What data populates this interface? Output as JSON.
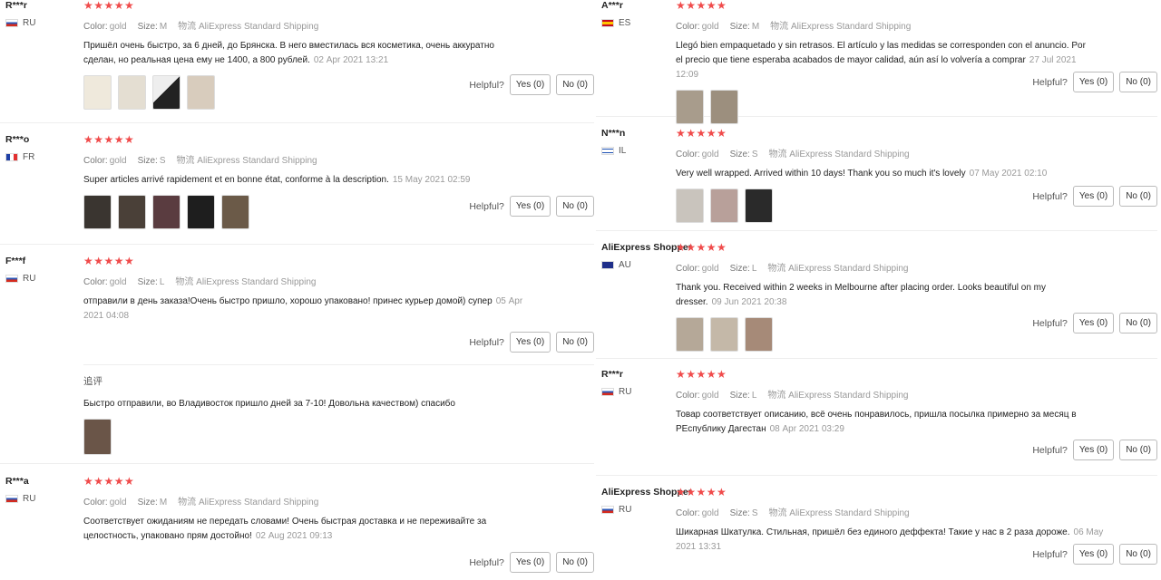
{
  "labels": {
    "color": "Color:",
    "size": "Size:",
    "shipping": "物流 AliExpress Standard Shipping",
    "helpful": "Helpful?",
    "yes": "Yes (0)",
    "no": "No (0)",
    "additional": "追评",
    "stars": "★★★★★"
  },
  "left": [
    {
      "name": "R***r",
      "country": "RU",
      "color": "gold",
      "size": "M",
      "text": "Пришёл очень быстро, за 6 дней, до Брянска. В него вместилась вся косметика, очень аккуратно сделан, но реальная цена ему не 1400, а 800 рублей.",
      "date": "02 Apr 2021 13:21",
      "photos": 4
    },
    {
      "name": "R***o",
      "country": "FR",
      "color": "gold",
      "size": "S",
      "text": "Super articles arrivé rapidement et en bonne état, conforme à la description.",
      "date": "15 May 2021 02:59",
      "photos": 5
    },
    {
      "name": "F***f",
      "country": "RU",
      "color": "gold",
      "size": "L",
      "text": "отправили в день заказа!Очень быстро пришло, хорошо упаковано! принес курьер домой) супер",
      "date": "05 Apr 2021 04:08",
      "photos": 0,
      "followup": {
        "text": "Быстро отправили, во Владивосток пришло дней за 7-10! Довольна качеством) спасибо",
        "photos": 1
      }
    },
    {
      "name": "R***a",
      "country": "RU",
      "color": "gold",
      "size": "M",
      "text": "Соответствует ожиданиям не передать словами! Очень быстрая доставка и не переживайте за целостность, упаковано прям достойно!",
      "date": "02 Aug 2021 09:13",
      "photos": 0
    }
  ],
  "right": [
    {
      "name": "A***r",
      "country": "ES",
      "color": "gold",
      "size": "M",
      "text": "Llegó bien empaquetado y sin retrasos. El artículo y las medidas se corresponden con el anuncio. Por el precio que tiene esperaba acabados de mayor calidad, aún así lo volvería a comprar",
      "date": "27 Jul 2021 12:09",
      "photos": 2
    },
    {
      "name": "N***n",
      "country": "IL",
      "color": "gold",
      "size": "S",
      "text": "Very well wrapped. Arrived within 10 days! Thank you so much it's lovely",
      "date": "07 May 2021 02:10",
      "photos": 3
    },
    {
      "name": "AliExpress Shopper",
      "country": "AU",
      "color": "gold",
      "size": "L",
      "text": "Thank you. Received within 2 weeks in Melbourne after placing order. Looks beautiful on my dresser.",
      "date": "09 Jun 2021 20:38",
      "photos": 3
    },
    {
      "name": "R***r",
      "country": "RU",
      "color": "gold",
      "size": "L",
      "text": "Товар соответствует описанию, всё очень понравилось, пришла посылка примерно за месяц в РЕспублику Дагестан",
      "date": "08 Apr 2021 03:29",
      "photos": 0
    },
    {
      "name": "AliExpress Shopper",
      "country": "RU",
      "color": "gold",
      "size": "S",
      "text": "Шикарная Шкатулка. Стильная, пришёл без единого деффекта! Такие у нас в 2 раза дороже.",
      "date": "06 May 2021 13:31",
      "photos": 0
    }
  ]
}
